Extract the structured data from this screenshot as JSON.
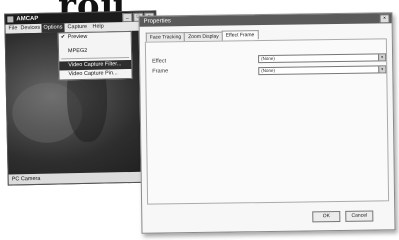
{
  "page_heading": "rou",
  "amcap": {
    "title": "AMCAP",
    "window_buttons": [
      "_",
      "□",
      "×"
    ],
    "menu": [
      "File",
      "Devices",
      "Options",
      "Capture",
      "Help"
    ],
    "active_menu": "Options",
    "status": "PC Camera",
    "options_menu": {
      "items": [
        {
          "label": "Preview",
          "checked": true
        },
        {
          "label": "MPEG2",
          "checked": false
        },
        {
          "label": "Video Capture Filter...",
          "checked": false,
          "highlighted": true
        },
        {
          "label": "Video Capture Pin...",
          "checked": false
        }
      ],
      "check_glyph": "✔"
    }
  },
  "dialog": {
    "title": "Properties",
    "close_glyph": "×",
    "tabs": [
      "Face Tracking",
      "Zoom Display",
      "Effect Frame"
    ],
    "selected_tab": "Effect Frame",
    "fields": [
      {
        "label": "Effect",
        "value": "(None)"
      },
      {
        "label": "Frame",
        "value": "(None)"
      }
    ],
    "dropdown_glyph": "▾",
    "buttons": {
      "ok": "OK",
      "cancel": "Cancel"
    }
  }
}
